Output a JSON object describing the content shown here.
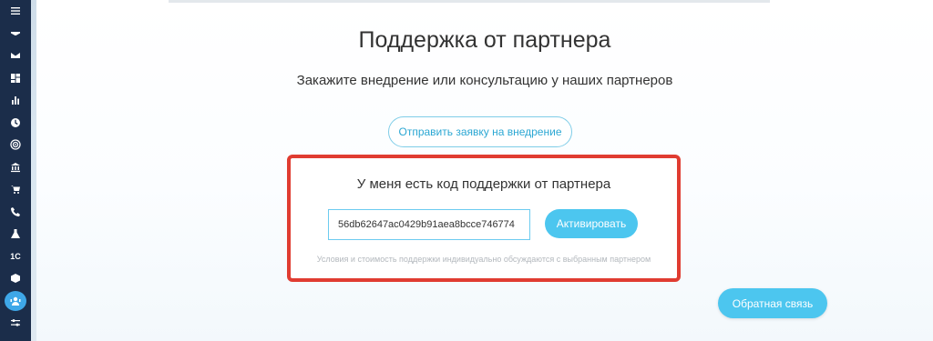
{
  "sidebar": {
    "icons": [
      "menu-icon",
      "feed-icon",
      "mail-icon",
      "dashboard-icon",
      "chart-icon",
      "clock-icon",
      "target-icon",
      "bank-icon",
      "cart-icon",
      "phone-icon",
      "flask-icon",
      "onec-icon",
      "box-icon",
      "partner-support-icon",
      "sliders-icon"
    ],
    "onec_label": "1С"
  },
  "page": {
    "title": "Поддержка от партнера",
    "subtitle": "Закажите внедрение или консультацию у наших партнеров",
    "request_button": "Отправить заявку на внедрение"
  },
  "support_code": {
    "title": "У меня есть код поддержки от партнера",
    "input_value": "56db62647ac0429b91aea8bcce746774",
    "activate_button": "Активировать",
    "note": "Условия и стоимость поддержки индивидуально обсуждаются с выбранным партнером"
  },
  "feedback_button": "Обратная связь",
  "colors": {
    "sidebar_bg": "#1b2d4a",
    "accent": "#4cc6ef",
    "highlight_border": "#e03c31"
  }
}
